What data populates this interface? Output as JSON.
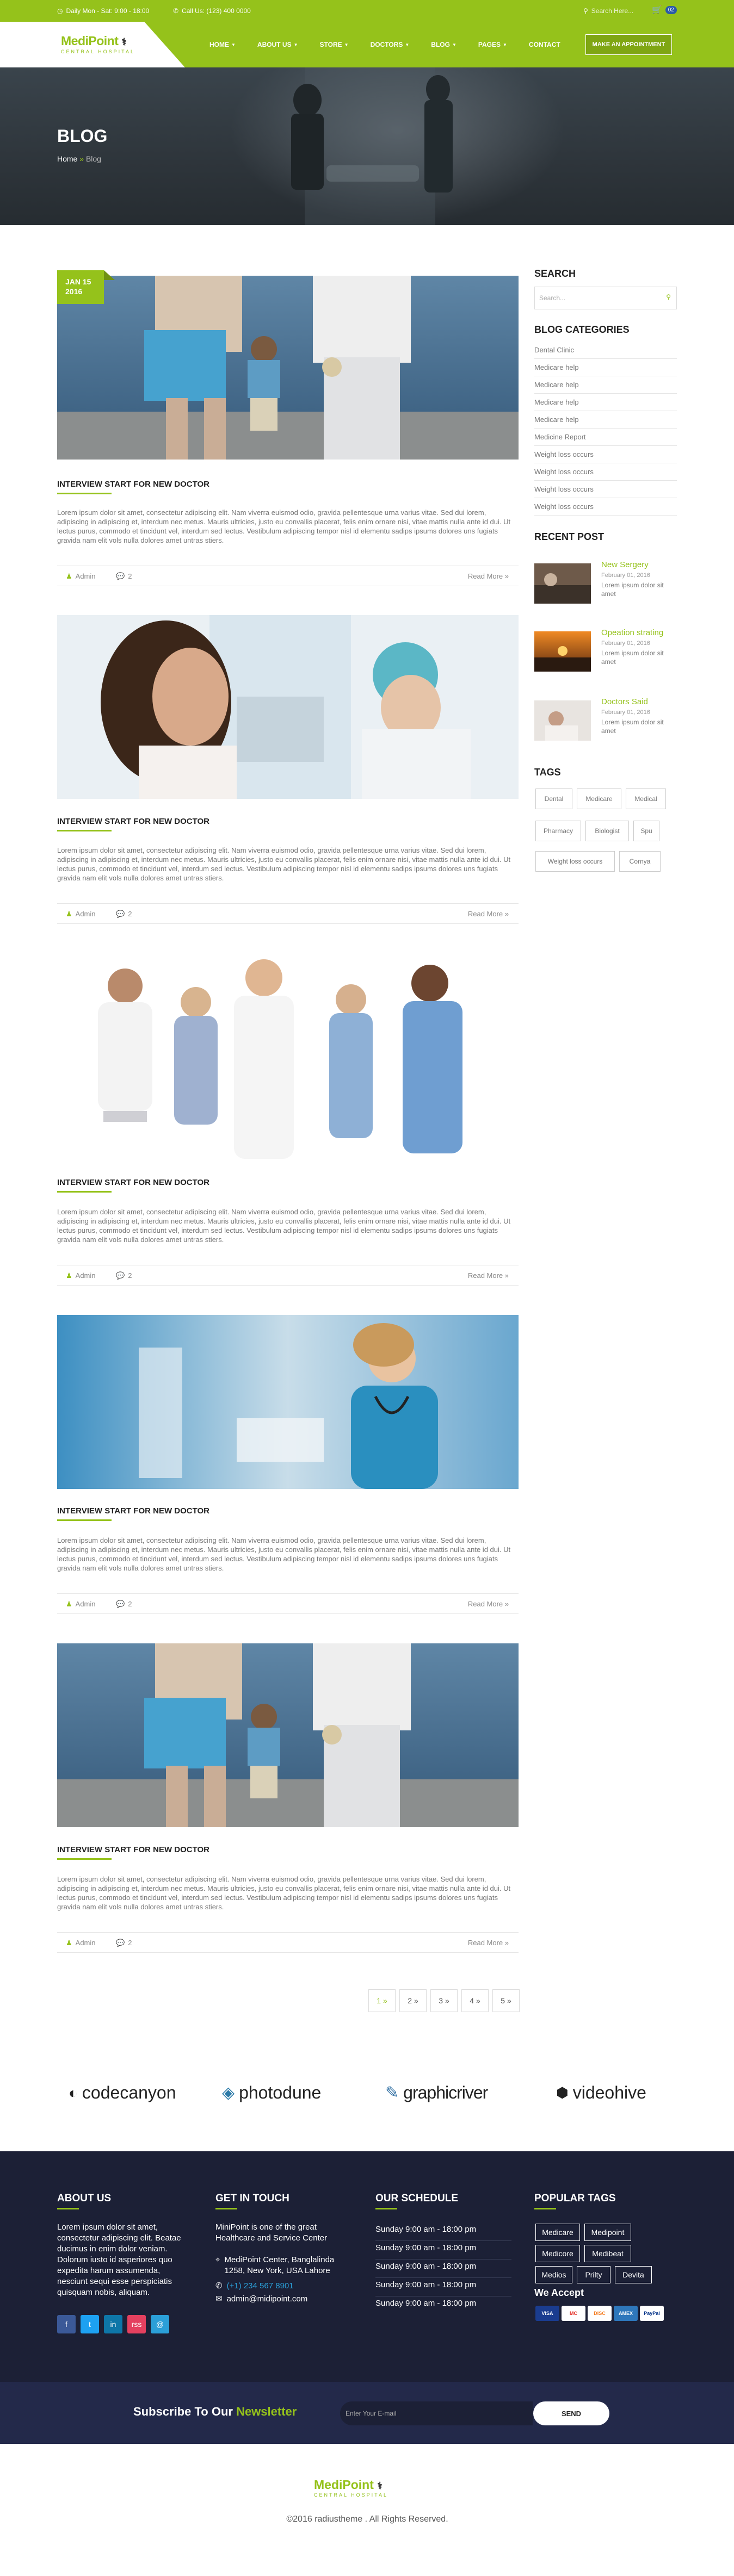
{
  "topbar": {
    "hours": "Daily Mon - Sat: 9:00 - 18:00",
    "phone": "Call Us: (123) 400 0000",
    "search_placeholder": "Search Here...",
    "cart_count": "02"
  },
  "logo": {
    "name_a": "Medi",
    "name_b": "Point",
    "tagline": "CENTRAL HOSPITAL"
  },
  "menu": [
    {
      "label": "HOME",
      "caret": true
    },
    {
      "label": "ABOUT US",
      "caret": true
    },
    {
      "label": "STORE",
      "caret": true
    },
    {
      "label": "DOCTORS",
      "caret": true
    },
    {
      "label": "BLOG",
      "caret": true
    },
    {
      "label": "PAGES",
      "caret": true
    },
    {
      "label": "CONTACT",
      "caret": false
    }
  ],
  "appointment_label": "MAKE AN APPOINTMENT",
  "hero": {
    "title": "BLOG",
    "bc_home": "Home",
    "bc_sep": "»",
    "bc_current": "Blog"
  },
  "date_badge": {
    "day": "JAN 15",
    "year": "2016"
  },
  "posts": [
    {
      "title": "INTERVIEW START FOR NEW DOCTOR",
      "excerpt": "Lorem ipsum dolor sit amet, consectetur adipiscing elit. Nam viverra euismod odio, gravida pellentesque urna varius vitae. Sed dui lorem, adipiscing in adipiscing et, interdum nec metus. Mauris ultricies, justo eu convallis placerat, felis enim ornare nisi, vitae mattis nulla ante id dui. Ut lectus purus, commodo et tincidunt vel, interdum sed lectus. Vestibulum adipiscing tempor nisl id elementu sadips ipsums dolores uns fugiats gravida nam elit vols nulla dolores amet untras stiers.",
      "author": "Admin",
      "comments": "2",
      "more": "Read More »"
    },
    {
      "title": "INTERVIEW START FOR NEW DOCTOR",
      "excerpt": "Lorem ipsum dolor sit amet, consectetur adipiscing elit. Nam viverra euismod odio, gravida pellentesque urna varius vitae. Sed dui lorem, adipiscing in adipiscing et, interdum nec metus. Mauris ultricies, justo eu convallis placerat, felis enim ornare nisi, vitae mattis nulla ante id dui. Ut lectus purus, commodo et tincidunt vel, interdum sed lectus. Vestibulum adipiscing tempor nisl id elementu sadips ipsums dolores uns fugiats gravida nam elit vols nulla dolores amet untras stiers.",
      "author": "Admin",
      "comments": "2",
      "more": "Read More »"
    },
    {
      "title": "INTERVIEW START FOR NEW DOCTOR",
      "excerpt": "Lorem ipsum dolor sit amet, consectetur adipiscing elit. Nam viverra euismod odio, gravida pellentesque urna varius vitae. Sed dui lorem, adipiscing in adipiscing et, interdum nec metus. Mauris ultricies, justo eu convallis placerat, felis enim ornare nisi, vitae mattis nulla ante id dui. Ut lectus purus, commodo et tincidunt vel, interdum sed lectus. Vestibulum adipiscing tempor nisl id elementu sadips ipsums dolores uns fugiats gravida nam elit vols nulla dolores amet untras stiers.",
      "author": "Admin",
      "comments": "2",
      "more": "Read More »"
    },
    {
      "title": "INTERVIEW START FOR NEW DOCTOR",
      "excerpt": "Lorem ipsum dolor sit amet, consectetur adipiscing elit. Nam viverra euismod odio, gravida pellentesque urna varius vitae. Sed dui lorem, adipiscing in adipiscing et, interdum nec metus. Mauris ultricies, justo eu convallis placerat, felis enim ornare nisi, vitae mattis nulla ante id dui. Ut lectus purus, commodo et tincidunt vel, interdum sed lectus. Vestibulum adipiscing tempor nisl id elementu sadips ipsums dolores uns fugiats gravida nam elit vols nulla dolores amet untras stiers.",
      "author": "Admin",
      "comments": "2",
      "more": "Read More »"
    },
    {
      "title": "INTERVIEW START FOR NEW DOCTOR",
      "excerpt": "Lorem ipsum dolor sit amet, consectetur adipiscing elit. Nam viverra euismod odio, gravida pellentesque urna varius vitae. Sed dui lorem, adipiscing in adipiscing et, interdum nec metus. Mauris ultricies, justo eu convallis placerat, felis enim ornare nisi, vitae mattis nulla ante id dui. Ut lectus purus, commodo et tincidunt vel, interdum sed lectus. Vestibulum adipiscing tempor nisl id elementu sadips ipsums dolores uns fugiats gravida nam elit vols nulla dolores amet untras stiers.",
      "author": "Admin",
      "comments": "2",
      "more": "Read More »"
    }
  ],
  "sidebar": {
    "search_title": "SEARCH",
    "search_placeholder": "Search...",
    "categories_title": "BLOG CATEGORIES",
    "categories": [
      "Dental Clinic",
      "Medicare help",
      "Medicare help",
      "Medicare help",
      "Medicare help",
      "Medicine Report",
      "Weight loss occurs",
      "Weight loss occurs",
      "Weight loss occurs",
      "Weight loss occurs"
    ],
    "recent_title": "RECENT POST",
    "recent": [
      {
        "title": "New Sergery",
        "date": "February 01, 2016",
        "text": "Lorem ipsum dolor sit amet"
      },
      {
        "title": "Opeation strating",
        "date": "February 01, 2016",
        "text": "Lorem ipsum dolor sit amet"
      },
      {
        "title": "Doctors Said",
        "date": "February 01, 2016",
        "text": "Lorem ipsum dolor sit amet"
      }
    ],
    "tags_title": "TAGS",
    "tags": [
      "Dental",
      "Medicare",
      "Medical",
      "Pharmacy",
      "Biologist",
      "Spu",
      "Weight loss occurs",
      "Cornya"
    ]
  },
  "pagination": [
    "1 »",
    "2 »",
    "3 »",
    "4 »",
    "5 »"
  ],
  "brands": [
    "codecanyon",
    "photodune",
    "graphicriver",
    "videohive"
  ],
  "footer": {
    "about_title": "ABOUT US",
    "about_text": "Lorem ipsum dolor sit amet, consectetur adipiscing elit. Beatae ducimus in enim dolor veniam. Dolorum iusto id asperiores quo expedita harum assumenda, nesciunt sequi esse perspiciatis quisquam nobis, aliquam.",
    "social": [
      "f",
      "t",
      "in",
      "rss",
      "@"
    ],
    "touch_title": "GET IN TOUCH",
    "touch_text": "MiniPoint is one of the great Healthcare and Service Center",
    "address": "MediPoint Center, Banglalinda 1258, New York, USA Lahore",
    "phone": "(+1) 234 567 8901",
    "email": "admin@midipoint.com",
    "schedule_title": "OUR SCHEDULE",
    "schedule": [
      "Sunday 9:00 am - 18:00 pm",
      "Sunday 9:00 am - 18:00 pm",
      "Sunday 9:00 am - 18:00 pm",
      "Sunday 9:00 am - 18:00 pm",
      "Sunday 9:00 am - 18:00 pm"
    ],
    "tags_title": "POPULAR TAGS",
    "popular_tags": [
      "Medicare",
      "Medipoint",
      "Medicore",
      "Medibeat",
      "Medios",
      "Prilty",
      "Devita"
    ],
    "accept_title": "We Accept",
    "cards": [
      "VISA",
      "MC",
      "DISC",
      "AMEX",
      "PayPal"
    ]
  },
  "newsletter": {
    "label_a": "Subscribe To Our ",
    "label_b": "Newsletter",
    "placeholder": "Enter Your E-mail",
    "button": "SEND"
  },
  "bottom": {
    "copyright": "©2016 radiustheme . All Rights Reserved."
  },
  "colors": {
    "accent": "#95c21b",
    "footer_bg": "#1c2036",
    "newsletter_bg": "#23294a"
  }
}
